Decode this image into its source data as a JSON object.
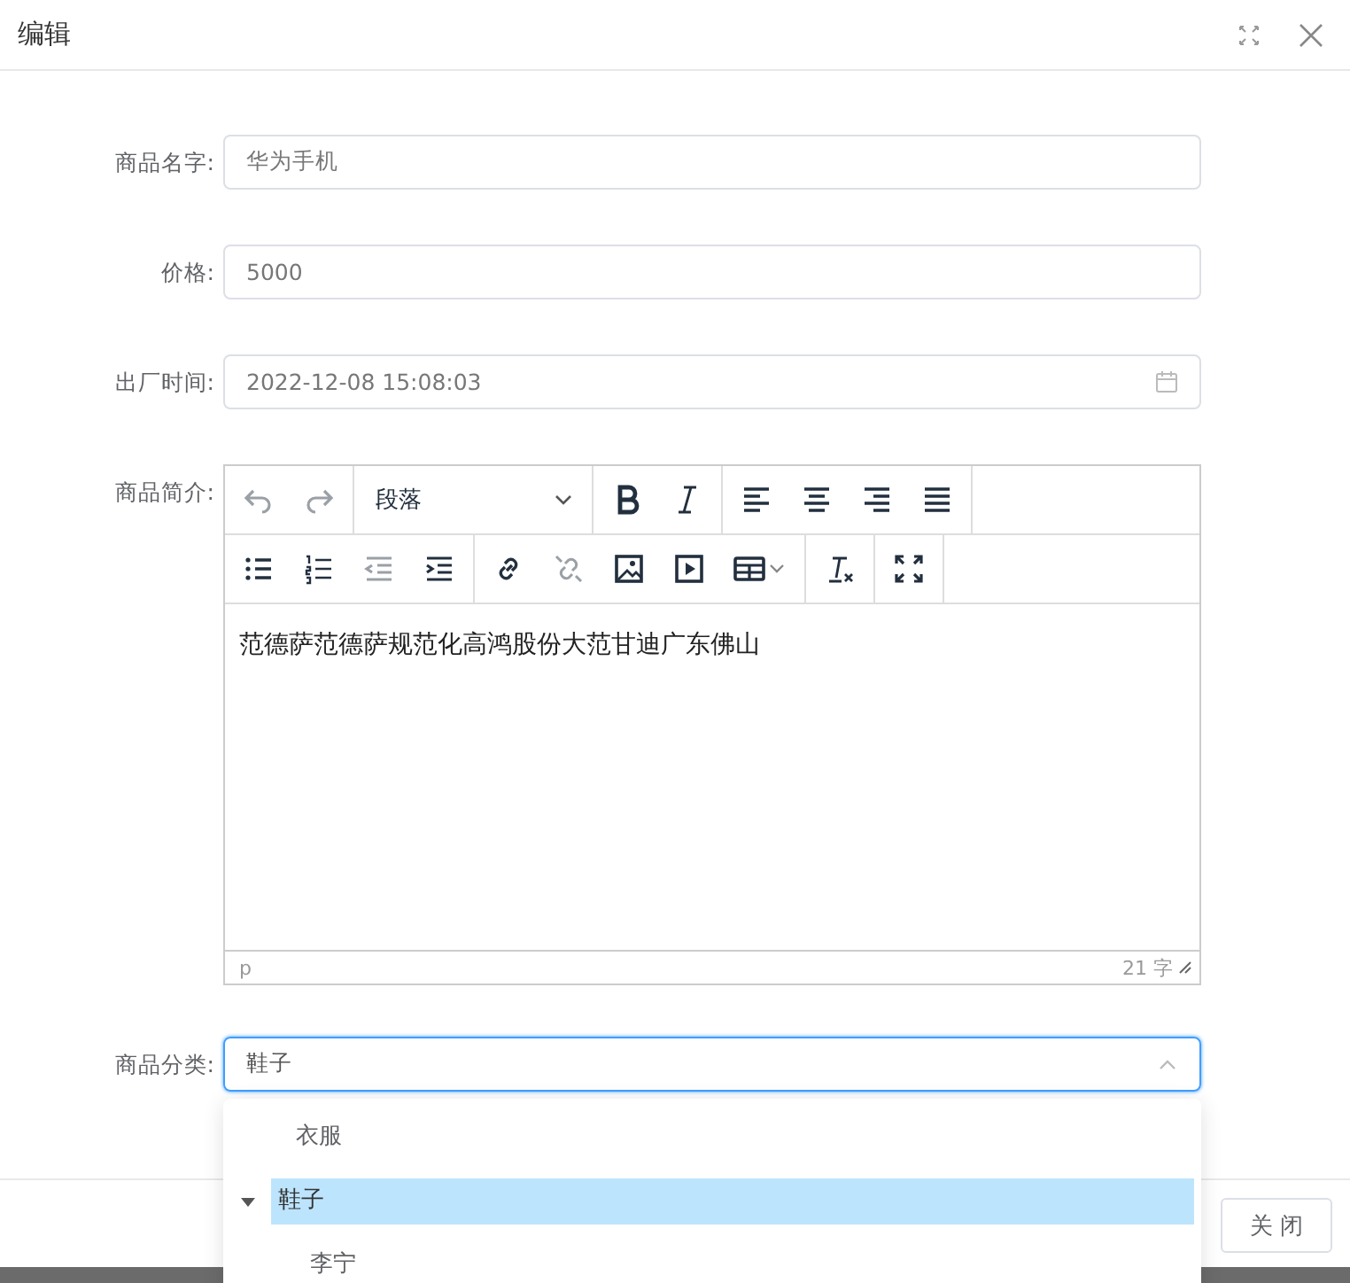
{
  "dialog": {
    "title": "编辑"
  },
  "fields": [
    {
      "label": "商品名字:",
      "value": "华为手机",
      "kind": "text"
    },
    {
      "label": "价格:",
      "value": "5000",
      "kind": "text"
    },
    {
      "label": "出厂时间:",
      "value": "2022-12-08 15:08:03",
      "kind": "date"
    }
  ],
  "editor": {
    "label": "商品简介:",
    "block_format": "段落",
    "tools": {
      "undo": {
        "disabled": true
      },
      "redo": {
        "disabled": true
      },
      "outdent": {
        "disabled": true
      },
      "unlink": {
        "disabled": true
      }
    },
    "content": "范德萨范德萨规范化高鸿股份大范甘迪广东佛山",
    "path": "p",
    "word_count": "21 字"
  },
  "category": {
    "label": "商品分类:",
    "value": "鞋子",
    "open": true,
    "options": [
      {
        "label": "衣服",
        "selected": false
      },
      {
        "label": "鞋子",
        "selected": true,
        "expanded": true,
        "children": [
          {
            "label": "李宁",
            "selected": false
          }
        ]
      }
    ]
  },
  "footer": {
    "close_button": "关 闭"
  }
}
